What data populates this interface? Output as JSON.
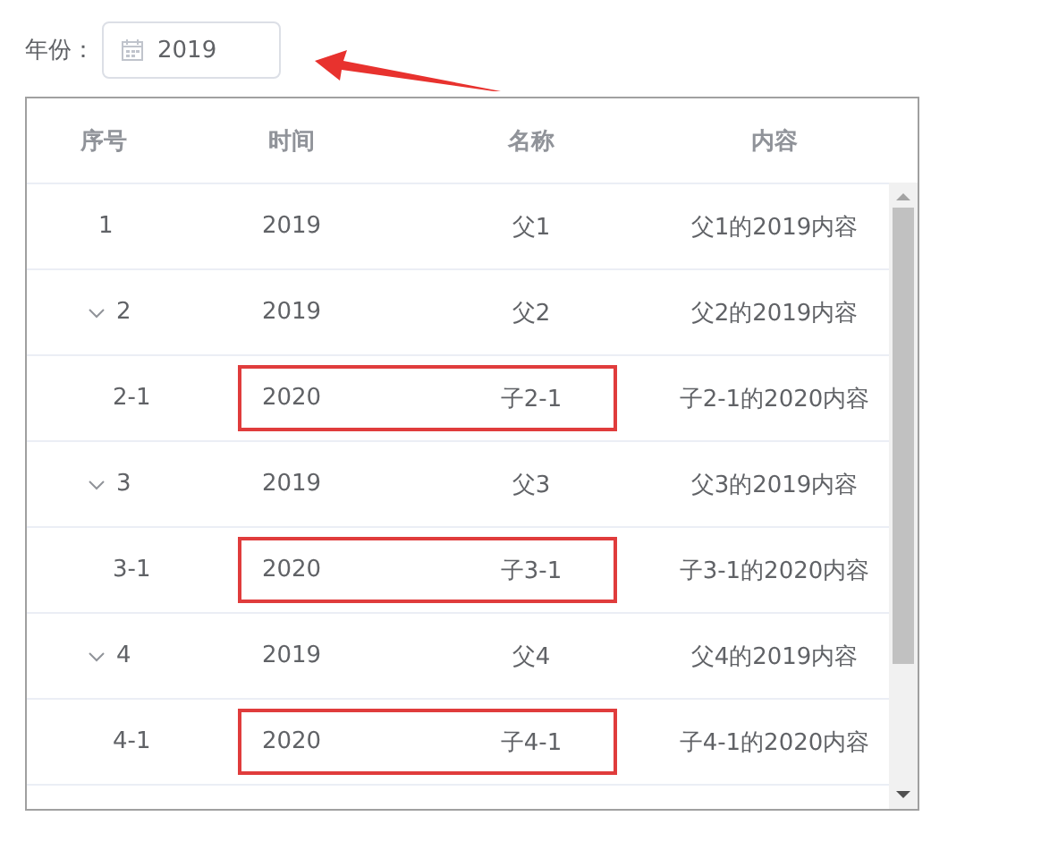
{
  "filter": {
    "label": "年份：",
    "value": "2019"
  },
  "table": {
    "columns": [
      "序号",
      "时间",
      "名称",
      "内容"
    ],
    "rows": [
      {
        "index": "1",
        "time": "2019",
        "name": "父1",
        "content": "父1的2019内容"
      },
      {
        "index": "2",
        "time": "2019",
        "name": "父2",
        "content": "父2的2019内容",
        "expanded": true,
        "children": [
          {
            "index": "2-1",
            "time": "2020",
            "name": "子2-1",
            "content": "子2-1的2020内容",
            "highlighted": true
          }
        ]
      },
      {
        "index": "3",
        "time": "2019",
        "name": "父3",
        "content": "父3的2019内容",
        "expanded": true,
        "children": [
          {
            "index": "3-1",
            "time": "2020",
            "name": "子3-1",
            "content": "子3-1的2020内容",
            "highlighted": true
          }
        ]
      },
      {
        "index": "4",
        "time": "2019",
        "name": "父4",
        "content": "父4的2019内容",
        "expanded": true,
        "children": [
          {
            "index": "4-1",
            "time": "2020",
            "name": "子4-1",
            "content": "子4-1的2020内容",
            "highlighted": true
          }
        ]
      }
    ]
  }
}
